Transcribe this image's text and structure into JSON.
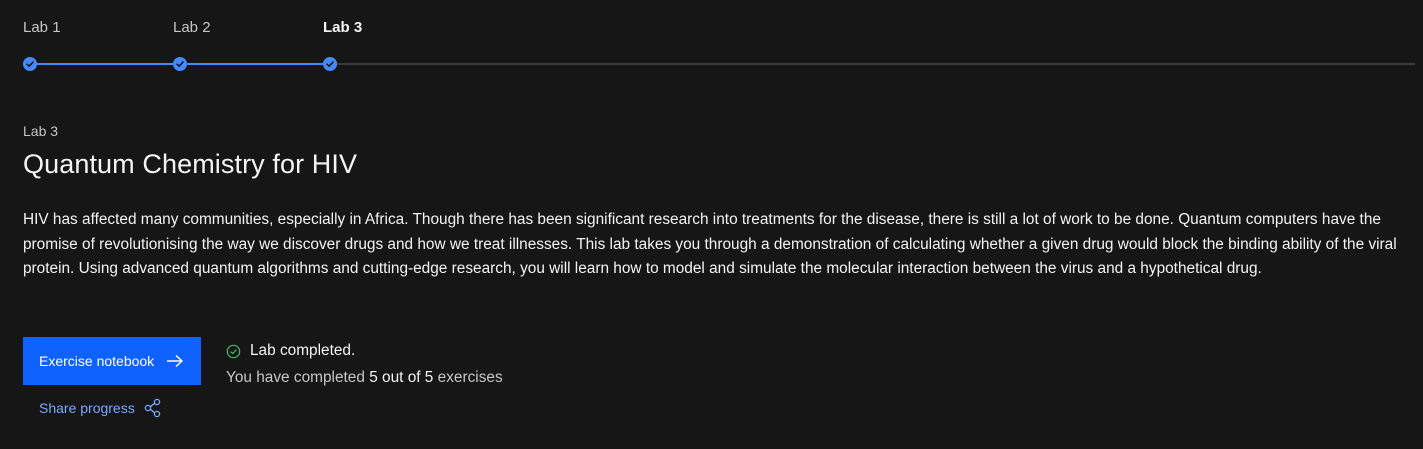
{
  "stepper": {
    "steps": [
      {
        "label": "Lab 1",
        "status": "complete"
      },
      {
        "label": "Lab 2",
        "status": "complete"
      },
      {
        "label": "Lab 3",
        "status": "current"
      }
    ],
    "progress_fraction_completed_steps": 3
  },
  "lab": {
    "eyebrow": "Lab 3",
    "title": "Quantum Chemistry for HIV",
    "description": "HIV has affected many communities, especially in Africa. Though there has been significant research into treatments for the disease, there is still a lot of work to be done. Quantum computers have the promise of revolutionising the way we discover drugs and how we treat illnesses. This lab takes you through a demonstration of calculating whether a given drug would block the binding ability of the viral protein. Using advanced quantum algorithms and cutting-edge research, you will learn how to model and simulate the molecular interaction between the virus and a hypothetical drug."
  },
  "actions": {
    "exercise_button_label": "Exercise notebook",
    "exercise_button_icon": "arrow-right-icon",
    "share_label": "Share progress",
    "share_icon": "share-icon"
  },
  "status": {
    "completed_text": "Lab completed.",
    "completed_icon": "checkmark-outline-icon",
    "progress_prefix": "You have completed",
    "progress_count": "5 out of 5",
    "progress_suffix": "exercises"
  },
  "colors": {
    "background": "#161616",
    "accent": "#4589ff",
    "button": "#0f62fe",
    "link": "#78a9ff",
    "success": "#42be65"
  }
}
